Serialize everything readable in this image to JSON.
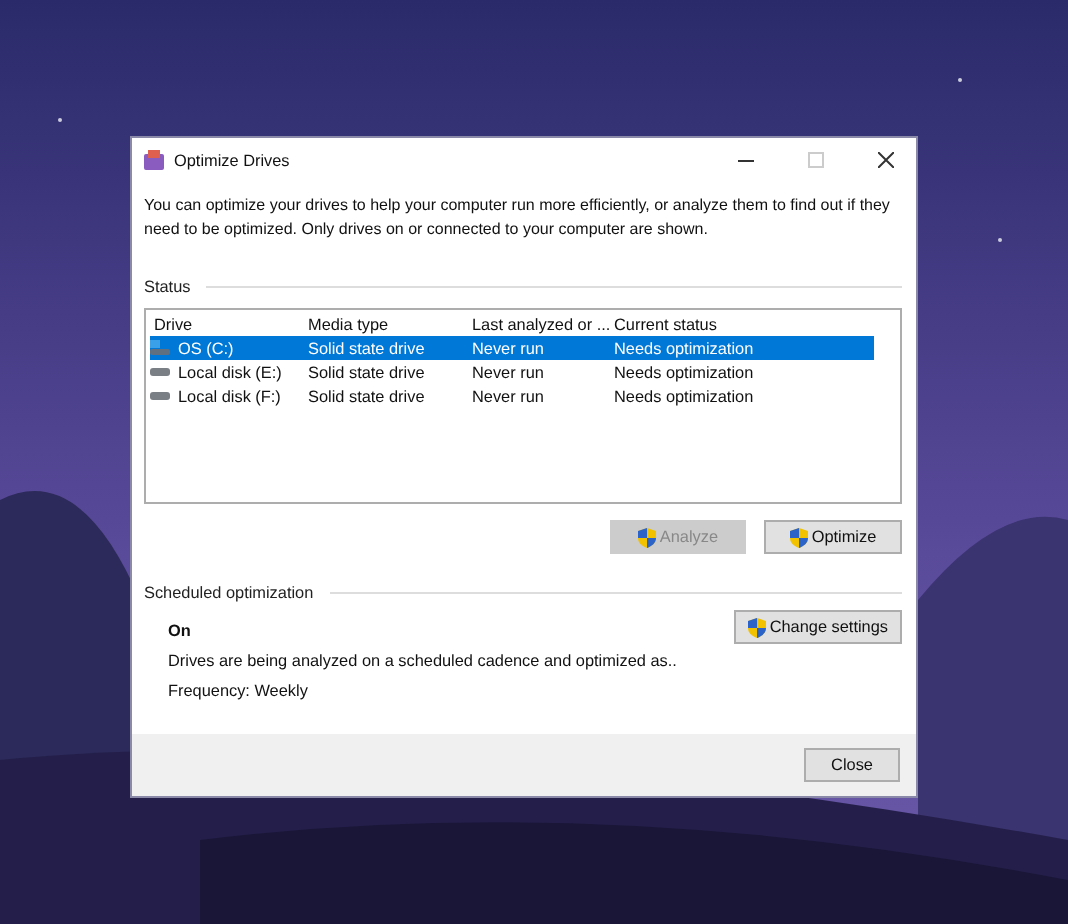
{
  "window": {
    "title": "Optimize Drives"
  },
  "description": "You can optimize your drives to help your computer run more efficiently, or analyze them to find out if they need to be optimized. Only drives on or connected to your computer are shown.",
  "status": {
    "heading": "Status",
    "columns": [
      "Drive",
      "Media type",
      "Last analyzed or ...",
      "Current status"
    ],
    "rows": [
      {
        "drive": "OS (C:)",
        "kind": "system",
        "media_type": "Solid state drive",
        "last_analyzed": "Never run",
        "current_status": "Needs optimization",
        "selected": true
      },
      {
        "drive": "Local disk (E:)",
        "kind": "local",
        "media_type": "Solid state drive",
        "last_analyzed": "Never run",
        "current_status": "Needs optimization",
        "selected": false
      },
      {
        "drive": "Local disk (F:)",
        "kind": "local",
        "media_type": "Solid state drive",
        "last_analyzed": "Never run",
        "current_status": "Needs optimization",
        "selected": false
      }
    ],
    "buttons": [
      {
        "label": "Analyze",
        "disabled": true
      },
      {
        "label": "Optimize",
        "disabled": false
      }
    ]
  },
  "scheduled": {
    "heading": "Scheduled optimization",
    "state": "On",
    "detail": "Drives are being analyzed on a scheduled cadence and optimized as..",
    "frequency": "Frequency: Weekly",
    "button": {
      "label": "Change settings",
      "disabled": false
    }
  },
  "footer": {
    "button": "Close"
  }
}
